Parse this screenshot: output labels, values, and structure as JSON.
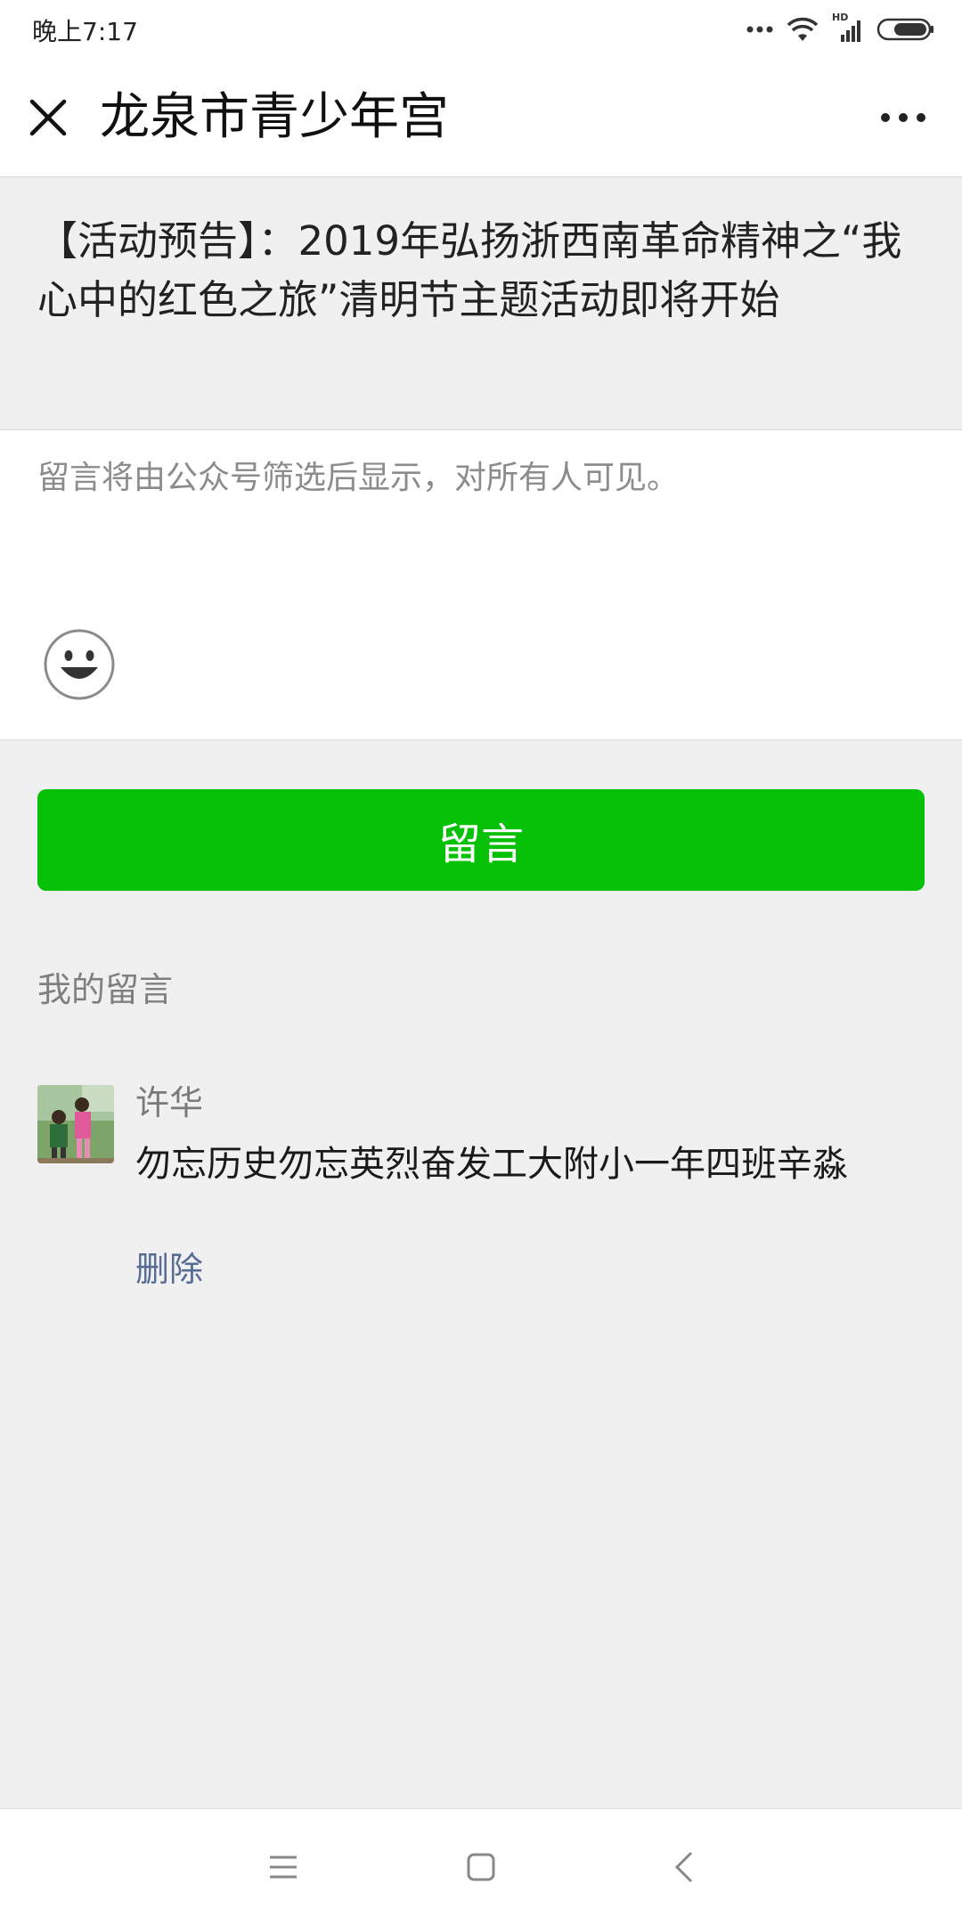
{
  "status_bar": {
    "time": "晚上7:17",
    "network_label": "HD"
  },
  "header": {
    "title": "龙泉市青少年宫"
  },
  "article": {
    "title": "【活动预告】：2019年弘扬浙西南革命精神之“我心中的红色之旅”清明节主题活动即将开始"
  },
  "comment_input": {
    "placeholder": "留言将由公众号筛选后显示，对所有人可见。",
    "value": ""
  },
  "submit_button": {
    "label": "留言",
    "color": "#06c106"
  },
  "my_comments": {
    "label": "我的留言",
    "items": [
      {
        "author": "许华",
        "text": "勿忘历史勿忘英烈奋发工大附小一年四班辛淼",
        "delete_label": "删除"
      }
    ]
  },
  "colors": {
    "accent": "#06c106",
    "link": "#576b95",
    "background": "#f0f0f0"
  },
  "icons": {
    "close": "close-icon",
    "more": "more-icon",
    "emoji": "emoji-icon",
    "nav_menu": "menu-icon",
    "nav_home": "home-icon",
    "nav_back": "back-icon"
  }
}
